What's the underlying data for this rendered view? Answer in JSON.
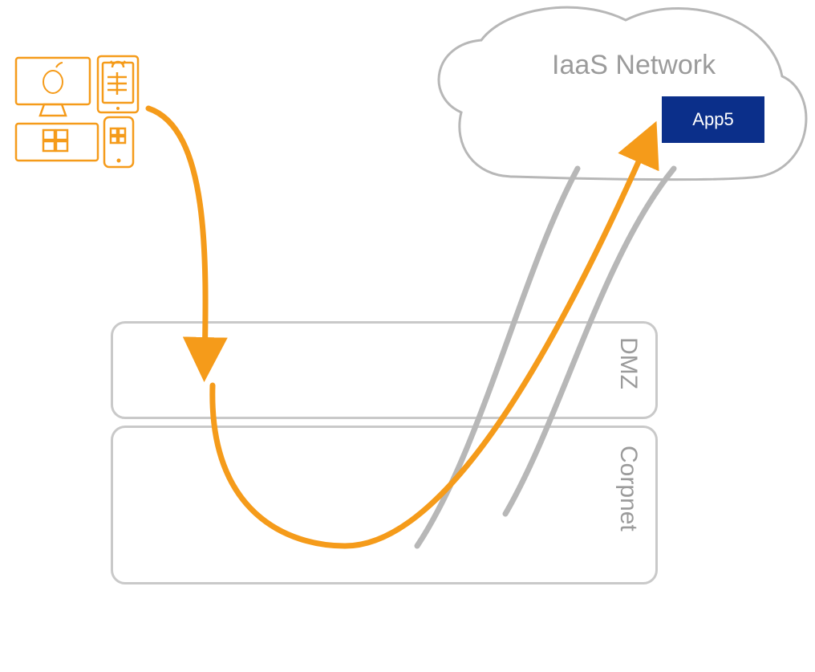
{
  "cloud": {
    "title": "IaaS Network"
  },
  "app": {
    "label": "App5",
    "color": "#0b2f8a"
  },
  "zones": {
    "dmz": "DMZ",
    "corpnet": "Corpnet"
  },
  "colors": {
    "orange": "#f59b1a",
    "gray": "#b7b7b7",
    "light_gray": "#c9c9c9",
    "text_gray": "#9b9b9b"
  }
}
